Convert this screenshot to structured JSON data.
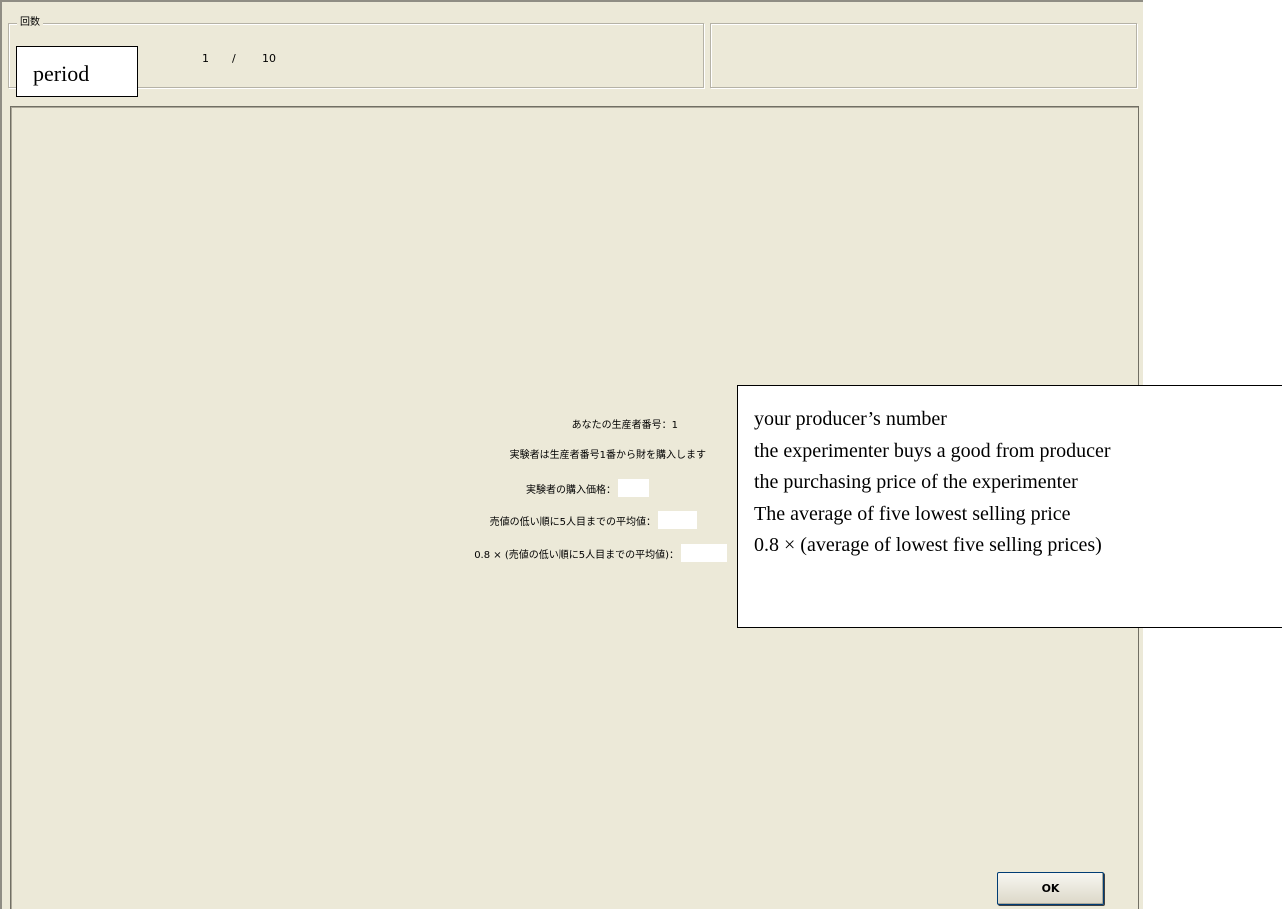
{
  "round_group": {
    "legend": "回数",
    "current": "1",
    "separator": "/",
    "total": "10"
  },
  "info": {
    "producer_number": "あなたの生産者番号：1",
    "experimenter_buys": "実験者は生産者番号1番から財を購入します",
    "purchase_price_label": "実験者の購入価格：",
    "average_label": "売値の低い順に5人目までの平均値：",
    "scaled_average_label": "0.8 × (売値の低い順に5人目までの平均値)："
  },
  "annotations": {
    "period": "period",
    "lines": [
      "your producer’s number",
      "the experimenter buys a good from producer",
      "the purchasing price of the experimenter",
      "The average of five lowest selling price",
      "0.8 × (average of lowest five selling prices)"
    ]
  },
  "ok_button": {
    "label": "OK"
  }
}
